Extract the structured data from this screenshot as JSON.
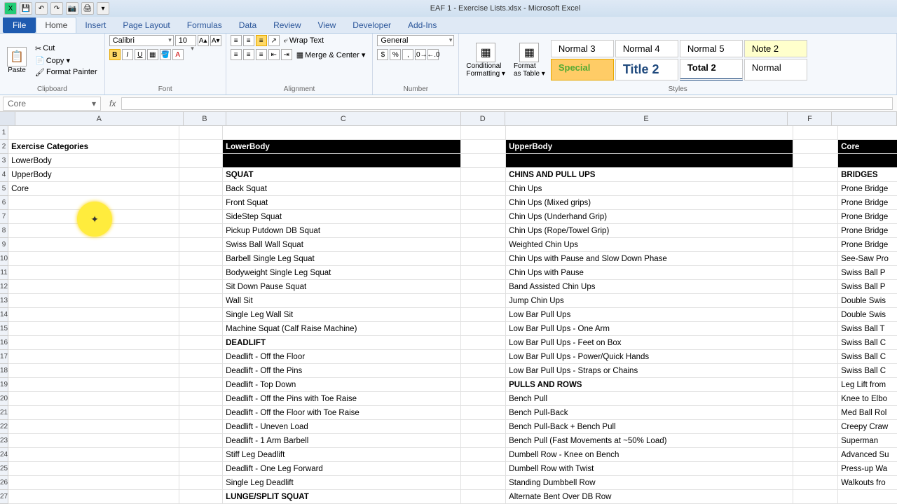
{
  "title": "EAF 1 - Exercise Lists.xlsx - Microsoft Excel",
  "tabs": [
    "File",
    "Home",
    "Insert",
    "Page Layout",
    "Formulas",
    "Data",
    "Review",
    "View",
    "Developer",
    "Add-Ins"
  ],
  "clipboard": {
    "label": "Clipboard",
    "paste": "Paste",
    "cut": "Cut",
    "copy": "Copy ▾",
    "fp": "Format Painter"
  },
  "font": {
    "label": "Font",
    "name": "Calibri",
    "size": "10",
    "b": "B",
    "i": "I",
    "u": "U"
  },
  "align": {
    "label": "Alignment",
    "wrap": "Wrap Text",
    "merge": "Merge & Center  ▾"
  },
  "number": {
    "label": "Number",
    "general": "General"
  },
  "styles": {
    "label": "Styles",
    "cond": "Conditional\nFormatting ▾",
    "table": "Format\nas Table ▾",
    "boxes": [
      {
        "t": "Normal 3",
        "cls": ""
      },
      {
        "t": "Normal 4",
        "cls": ""
      },
      {
        "t": "Normal 5",
        "cls": ""
      },
      {
        "t": "Note 2",
        "cls": "style-note2"
      },
      {
        "t": "Special",
        "cls": "style-special"
      },
      {
        "t": "Title 2",
        "cls": "style-title2"
      },
      {
        "t": "Total 2",
        "cls": "style-total2"
      },
      {
        "t": "Normal",
        "cls": ""
      }
    ]
  },
  "nameBox": "Core",
  "cols": [
    "A",
    "B",
    "C",
    "D",
    "E",
    "F"
  ],
  "rows": [
    {
      "A": "",
      "C": "",
      "E": "",
      "G": ""
    },
    {
      "A": "Exercise Categories",
      "Abold": true,
      "Cblack": true,
      "C": "LowerBody",
      "Eblack": true,
      "E": "UpperBody",
      "Gblack": true,
      "G": "Core"
    },
    {
      "A": "LowerBody",
      "Cblack": true,
      "C": "",
      "Eblack": true,
      "E": "",
      "Gblack": true,
      "G": ""
    },
    {
      "A": "UpperBody",
      "C": "SQUAT",
      "Cbold": true,
      "E": "CHINS AND PULL UPS",
      "Ebold": true,
      "G": "BRIDGES",
      "Gbold": true
    },
    {
      "A": "Core",
      "C": "Back Squat",
      "E": "Chin Ups",
      "G": "Prone Bridge"
    },
    {
      "A": "",
      "C": "Front Squat",
      "E": "Chin Ups (Mixed grips)",
      "G": "Prone Bridge"
    },
    {
      "A": "",
      "C": "SideStep Squat",
      "E": "Chin Ups (Underhand Grip)",
      "G": "Prone Bridge"
    },
    {
      "A": "",
      "C": "Pickup Putdown DB Squat",
      "E": "Chin Ups (Rope/Towel Grip)",
      "G": "Prone Bridge"
    },
    {
      "A": "",
      "C": "Swiss Ball Wall Squat",
      "E": "Weighted Chin Ups",
      "G": "Prone Bridge"
    },
    {
      "A": "",
      "C": "Barbell Single Leg Squat",
      "E": "Chin Ups with Pause and Slow Down Phase",
      "G": "See-Saw Pro"
    },
    {
      "A": "",
      "C": "Bodyweight Single Leg Squat",
      "E": "Chin Ups with Pause",
      "G": "Swiss Ball P"
    },
    {
      "A": "",
      "C": "Sit Down Pause Squat",
      "E": "Band Assisted Chin Ups",
      "G": "Swiss Ball P"
    },
    {
      "A": "",
      "C": "Wall Sit",
      "E": "Jump Chin Ups",
      "G": "Double Swis"
    },
    {
      "A": "",
      "C": "Single Leg Wall Sit",
      "E": "Low Bar Pull Ups",
      "G": "Double Swis"
    },
    {
      "A": "",
      "C": "Machine Squat (Calf Raise Machine)",
      "E": "Low Bar Pull Ups - One Arm",
      "G": "Swiss Ball T"
    },
    {
      "A": "",
      "C": "DEADLIFT",
      "Cbold": true,
      "E": "Low Bar Pull Ups - Feet on Box",
      "G": "Swiss Ball C"
    },
    {
      "A": "",
      "C": "Deadlift - Off the Floor",
      "E": "Low Bar Pull Ups - Power/Quick Hands",
      "G": "Swiss Ball C"
    },
    {
      "A": "",
      "C": "Deadlift - Off the Pins",
      "E": "Low Bar Pull Ups - Straps or Chains",
      "G": "Swiss Ball C"
    },
    {
      "A": "",
      "C": "Deadlift - Top Down",
      "E": "PULLS AND ROWS",
      "Ebold": true,
      "G": "Leg Lift from"
    },
    {
      "A": "",
      "C": "Deadlift - Off the Pins with Toe Raise",
      "E": "Bench Pull",
      "G": "Knee to Elbo"
    },
    {
      "A": "",
      "C": "Deadlift - Off the Floor with Toe Raise",
      "E": "Bench Pull-Back",
      "G": "Med Ball Rol"
    },
    {
      "A": "",
      "C": "Deadlift - Uneven Load",
      "E": "Bench Pull-Back + Bench Pull",
      "G": "Creepy Craw"
    },
    {
      "A": "",
      "C": "Deadlift - 1 Arm Barbell",
      "E": "Bench Pull (Fast Movements at ~50% Load)",
      "G": "Superman"
    },
    {
      "A": "",
      "C": "Stiff Leg Deadlift",
      "E": "Dumbell Row - Knee on Bench",
      "G": "Advanced Su"
    },
    {
      "A": "",
      "C": "Deadlift - One Leg Forward",
      "E": "Dumbell Row with Twist",
      "G": "Press-up Wa"
    },
    {
      "A": "",
      "C": "Single Leg Deadlift",
      "E": "Standing Dumbbell Row",
      "G": "Walkouts fro"
    },
    {
      "A": "",
      "C": "LUNGE/SPLIT SQUAT",
      "Cbold": true,
      "E": "Alternate Bent Over DB Row",
      "G": ""
    }
  ]
}
